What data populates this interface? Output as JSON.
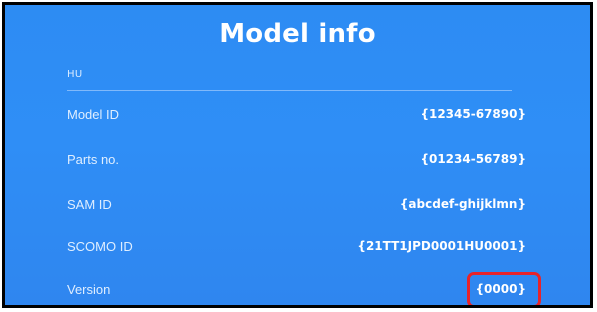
{
  "title": "Model info",
  "section_label": "HU",
  "rows": [
    {
      "label": "Model ID",
      "value": "{12345-67890}"
    },
    {
      "label": "Parts no.",
      "value": "{01234-56789}"
    },
    {
      "label": "SAM ID",
      "value": "{abcdef-ghijklmn}"
    },
    {
      "label": "SCOMO ID",
      "value": "{21TT1JPD0001HU0001}"
    },
    {
      "label": "Version",
      "value": "{0000}"
    }
  ],
  "colors": {
    "background": "#2f8ef6",
    "highlight": "#e8232a"
  }
}
